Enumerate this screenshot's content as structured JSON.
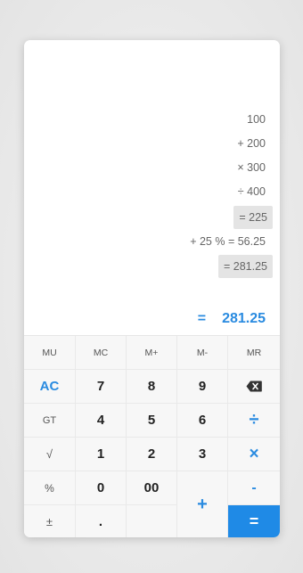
{
  "tape": {
    "lines": [
      "100",
      "+ 200",
      "× 300",
      "÷ 400",
      "= 225",
      "+ 25 %  =  56.25",
      "= 281.25"
    ]
  },
  "result": {
    "equals_sign": "=",
    "value": "281.25"
  },
  "memory_keys": [
    "MU",
    "MC",
    "M+",
    "M-",
    "MR"
  ],
  "keys": {
    "ac": "AC",
    "seven": "7",
    "eight": "8",
    "nine": "9",
    "gt": "GT",
    "four": "4",
    "five": "5",
    "six": "6",
    "divide": "÷",
    "sqrt": "√",
    "one": "1",
    "two": "2",
    "three": "3",
    "multiply": "×",
    "percent": "%",
    "zero": "0",
    "double_zero": "00",
    "minus": "-",
    "plus": "+",
    "sign": "±",
    "decimal": ".",
    "equals": "="
  },
  "colors": {
    "accent": "#2a8be0",
    "equals_bg": "#1f8ae6",
    "highlight_bg": "#e4e4e4"
  },
  "icons": {
    "backspace": "backspace-icon"
  }
}
